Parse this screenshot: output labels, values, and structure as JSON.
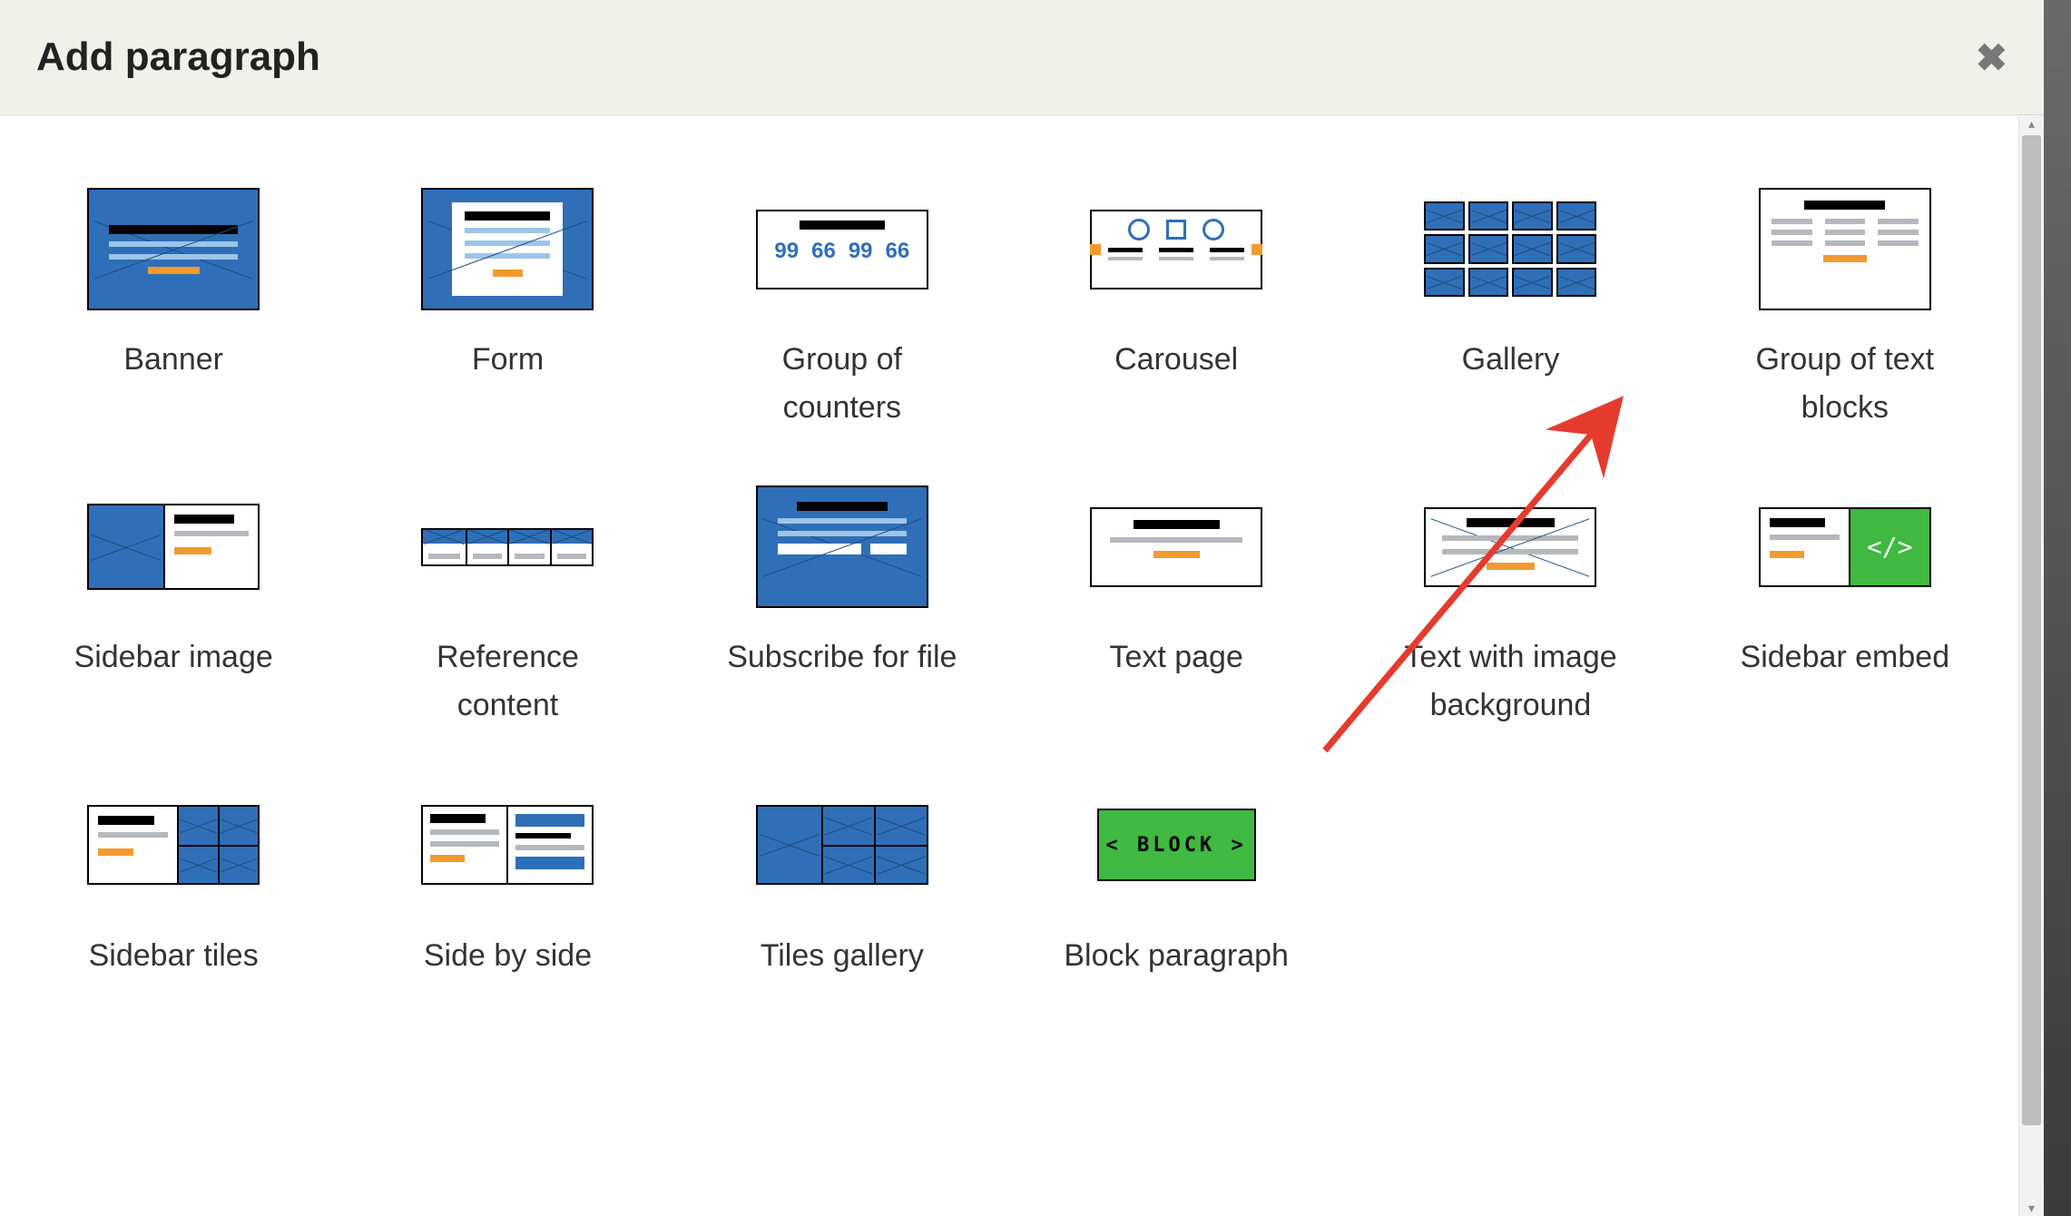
{
  "modal": {
    "title": "Add paragraph",
    "close": "✖"
  },
  "counters": {
    "nums": [
      "99",
      "66",
      "99",
      "66"
    ]
  },
  "embed_code": "</>",
  "block_text": "< BLOCK >",
  "tiles": [
    {
      "id": "banner",
      "label": "Banner"
    },
    {
      "id": "form",
      "label": "Form"
    },
    {
      "id": "group-of-counters",
      "label": "Group of counters"
    },
    {
      "id": "carousel",
      "label": "Carousel"
    },
    {
      "id": "gallery",
      "label": "Gallery"
    },
    {
      "id": "group-of-text",
      "label": "Group of text blocks"
    },
    {
      "id": "sidebar-image",
      "label": "Sidebar image"
    },
    {
      "id": "reference-content",
      "label": "Reference content"
    },
    {
      "id": "subscribe-for-file",
      "label": "Subscribe for file"
    },
    {
      "id": "text-page",
      "label": "Text page"
    },
    {
      "id": "text-with-img-bg",
      "label": "Text with image background"
    },
    {
      "id": "sidebar-embed",
      "label": "Sidebar embed"
    },
    {
      "id": "sidebar-tiles",
      "label": "Sidebar tiles"
    },
    {
      "id": "side-by-side",
      "label": "Side by side"
    },
    {
      "id": "tiles-gallery",
      "label": "Tiles gallery"
    },
    {
      "id": "block-paragraph",
      "label": "Block paragraph"
    }
  ]
}
